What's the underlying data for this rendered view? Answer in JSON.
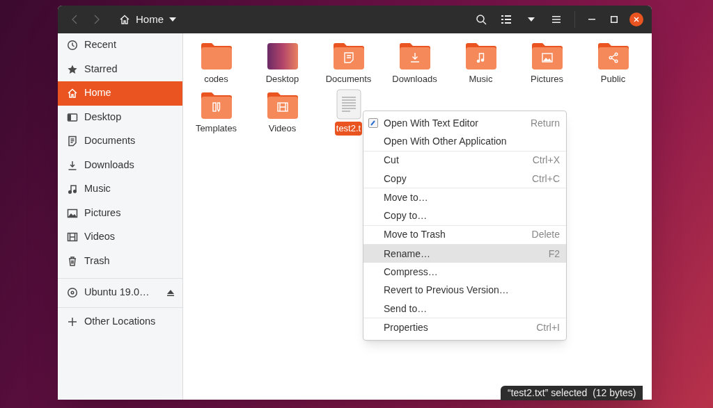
{
  "header": {
    "back": {
      "disabled": true
    },
    "forward": {
      "disabled": true
    },
    "location": "Home"
  },
  "sidebar": {
    "sections": [
      {
        "items": [
          {
            "label": "Recent",
            "kind": "recent",
            "selected": false
          },
          {
            "label": "Starred",
            "kind": "starred",
            "selected": false
          },
          {
            "label": "Home",
            "kind": "home",
            "selected": true
          },
          {
            "label": "Desktop",
            "kind": "desktop",
            "selected": false
          },
          {
            "label": "Documents",
            "kind": "documents",
            "selected": false
          },
          {
            "label": "Downloads",
            "kind": "downloads",
            "selected": false
          },
          {
            "label": "Music",
            "kind": "music",
            "selected": false
          },
          {
            "label": "Pictures",
            "kind": "pictures",
            "selected": false
          },
          {
            "label": "Videos",
            "kind": "videos",
            "selected": false
          },
          {
            "label": "Trash",
            "kind": "trash",
            "selected": false
          }
        ]
      },
      {
        "items": [
          {
            "label": "Ubuntu 19.0…",
            "kind": "disc",
            "selected": false,
            "ejectable": true
          }
        ]
      },
      {
        "items": [
          {
            "label": "Other Locations",
            "kind": "other",
            "selected": false
          }
        ]
      }
    ]
  },
  "files": [
    {
      "name": "codes",
      "kind": "plain",
      "selected": false
    },
    {
      "name": "Desktop",
      "kind": "desktop",
      "selected": false
    },
    {
      "name": "Documents",
      "kind": "documents",
      "selected": false
    },
    {
      "name": "Downloads",
      "kind": "downloads",
      "selected": false
    },
    {
      "name": "Music",
      "kind": "music",
      "selected": false
    },
    {
      "name": "Pictures",
      "kind": "pictures",
      "selected": false
    },
    {
      "name": "Public",
      "kind": "public",
      "selected": false
    },
    {
      "name": "Templates",
      "kind": "templates",
      "selected": false
    },
    {
      "name": "Videos",
      "kind": "videos",
      "selected": false
    },
    {
      "name": "test2.t",
      "kind": "text",
      "selected": true
    }
  ],
  "context_menu": {
    "sections": [
      {
        "items": [
          {
            "label": "Open With Text Editor",
            "shortcut": "Return",
            "has_icon": true,
            "selected": false
          },
          {
            "label": "Open With Other Application",
            "selected": false
          }
        ]
      },
      {
        "items": [
          {
            "label": "Cut",
            "shortcut": "Ctrl+X",
            "selected": false
          },
          {
            "label": "Copy",
            "shortcut": "Ctrl+C",
            "selected": false
          }
        ]
      },
      {
        "items": [
          {
            "label": "Move to…",
            "selected": false
          },
          {
            "label": "Copy to…",
            "selected": false
          }
        ]
      },
      {
        "items": [
          {
            "label": "Move to Trash",
            "shortcut": "Delete",
            "selected": false
          }
        ]
      },
      {
        "items": [
          {
            "label": "Rename…",
            "shortcut": "F2",
            "selected": true
          },
          {
            "label": "Compress…",
            "selected": false
          },
          {
            "label": "Revert to Previous Version…",
            "selected": false
          },
          {
            "label": "Send to…",
            "selected": false
          }
        ]
      },
      {
        "items": [
          {
            "label": "Properties",
            "shortcut": "Ctrl+I",
            "selected": false
          }
        ]
      }
    ]
  },
  "status": "“test2.txt” selected  (12 bytes)"
}
